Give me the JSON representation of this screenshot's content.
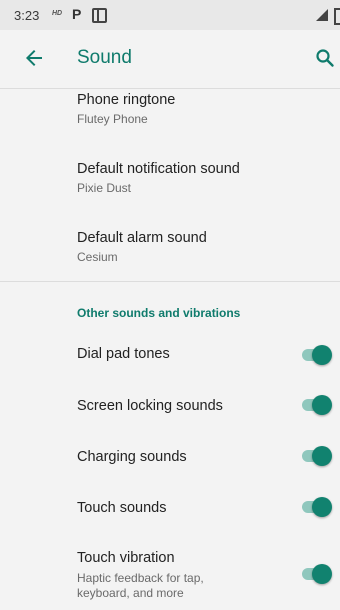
{
  "status_bar": {
    "time": "3:23",
    "hd_label": "HD"
  },
  "app_bar": {
    "title": "Sound",
    "back_icon": "arrow-back-icon",
    "search_icon": "search-icon"
  },
  "settings": [
    {
      "label": "Phone ringtone",
      "value": "Flutey Phone"
    },
    {
      "label": "Default notification sound",
      "value": "Pixie Dust"
    },
    {
      "label": "Default alarm sound",
      "value": "Cesium"
    }
  ],
  "section_header": "Other sounds and vibrations",
  "toggles": [
    {
      "label": "Dial pad tones",
      "on": true
    },
    {
      "label": "Screen locking sounds",
      "on": true
    },
    {
      "label": "Charging sounds",
      "on": true
    },
    {
      "label": "Touch sounds",
      "on": true
    },
    {
      "label": "Touch vibration",
      "summary_line1": "Haptic feedback for tap,",
      "summary_line2": "keyboard, and more",
      "on": true
    }
  ],
  "colors": {
    "accent": "#0f7b6c",
    "toggle_track": "#8fc7bd",
    "background": "#f3f3f3"
  }
}
